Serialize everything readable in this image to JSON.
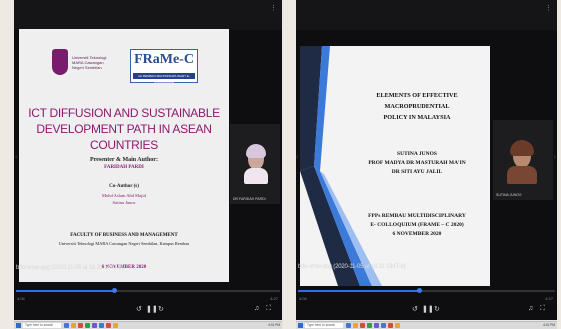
{
  "left_screen": {
    "slide": {
      "logo_text": "Universiti Teknologi MARA Cawangan Negeri Sembilan",
      "badge_title": "FRaMe-C",
      "badge_sub": "1st REMBAU MULTIDISCIPLINARY E-COLLOQUIUM",
      "title": "ICT DIFFUSION AND SUSTAINABLE DEVELOPMENT PATH IN ASEAN COUNTRIES",
      "presenter_heading": "Presenter & Main Author:",
      "presenter_name": "FARIDAH PARDI",
      "coauthor_heading": "Co-Author (s)",
      "coauthors": [
        "Mohd Aslam Abd Majid",
        "Sutina Junos"
      ],
      "faculty": "FACULTY OF BUSINESS AND MANAGEMENT",
      "university": "Universiti Teknologi MARA Cawangan Negeri Sembilan, Kampus Rembau",
      "date": "6 NOVEMBER 2020"
    },
    "participant_label": "DR FARIDAH PARDI",
    "recording_caption": "bdo-xmw-qsg (2020-11-05 at 16.31 GMT-8)",
    "time_elapsed": "4:04",
    "time_total": "4:27"
  },
  "right_screen": {
    "slide": {
      "title_lines": [
        "ELEMENTS OF EFFECTIVE MACROPRUDENTIAL",
        "POLICY IN MALAYSIA"
      ],
      "names": [
        "SUTINA JUNOS",
        "PROF MADYA DR MASTURAH MA'IN",
        "DR SITI AYU JALIL"
      ],
      "event_lines": [
        "FPPs REMBAU MULTIDISCIPLINARY",
        "E- COLLOQUIUM (FRAME – C 2020)",
        "6 NOVEMBER 2020"
      ]
    },
    "participant_label": "SUTINA JUNOS",
    "recording_caption": "bdo-xmw-qsg (2020-11-05 at 16.31 GMT-8)",
    "time_elapsed": "4:04",
    "time_total": "4:27"
  },
  "taskbar": {
    "search_placeholder": "Type here to search",
    "clock": "4:31 PM"
  },
  "progress": {
    "left_fraction": 0.37,
    "right_fraction": 0.47
  },
  "colors": {
    "accent_purple": "#8b1a6f",
    "progress_blue": "#2f6fe0",
    "frame_blue": "#2a4c8e"
  }
}
